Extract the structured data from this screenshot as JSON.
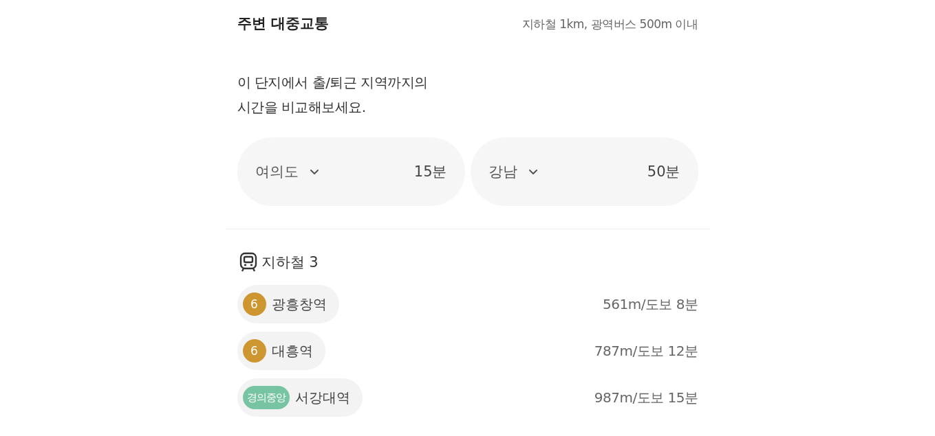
{
  "section": {
    "title": "주변 대중교통",
    "subtitle": "지하철 1km, 광역버스 500m 이내"
  },
  "description": "이 단지에서 출/퇴근 지역까지의\n시간을 비교해보세요.",
  "commutes": [
    {
      "destination": "여의도",
      "time": "15분"
    },
    {
      "destination": "강남",
      "time": "50분"
    }
  ],
  "subway": {
    "label": "지하철 3",
    "stations": [
      {
        "line": "6",
        "kind": "circle",
        "color": "#cd9630",
        "name": "광흥창역",
        "distance": "561m/도보 8분"
      },
      {
        "line": "6",
        "kind": "circle",
        "color": "#cd9630",
        "name": "대흥역",
        "distance": "787m/도보 12분"
      },
      {
        "line": "경의중앙",
        "kind": "label",
        "color": "#77c4a3",
        "name": "서강대역",
        "distance": "987m/도보 15분"
      }
    ]
  }
}
